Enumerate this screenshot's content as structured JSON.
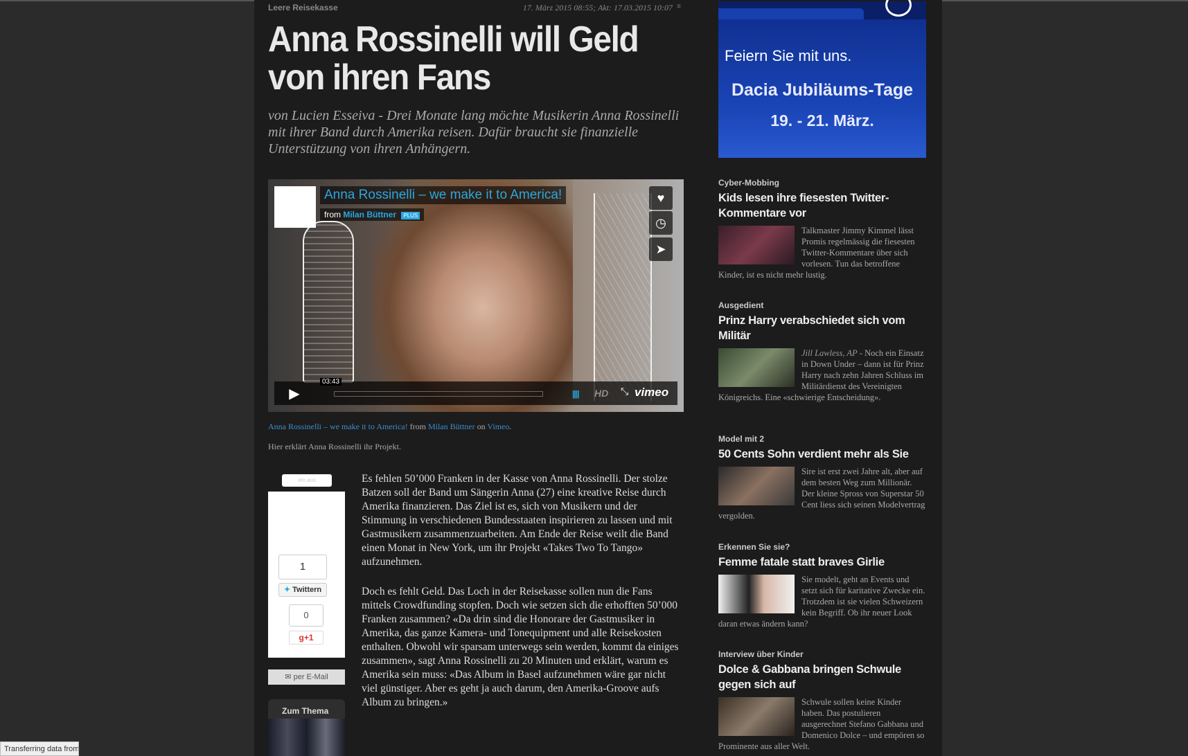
{
  "article": {
    "kicker": "Leere Reisekasse",
    "published": "17. März 2015 08:55;",
    "updated_label": "Akt:",
    "updated": "17.03.2015 10:07",
    "headline": "Anna Rossinelli will Geld von ihren Fans",
    "lead": "von Lucien Esseiva - Drei Monate lang möchte Musikerin Anna Rossinelli mit ihrer Band durch Amerika reisen. Dafür braucht sie finanzielle Unterstützung von ihren Anhängern.",
    "video": {
      "title": "Anna Rossinelli – we make it to America!",
      "from_label": "from",
      "author": "Milan Büttner",
      "plus_badge": "PLUS",
      "duration": "03:43",
      "hd_label": "HD",
      "brand": "vimeo",
      "side_buttons": [
        "heart-icon",
        "clock-icon",
        "send-icon"
      ]
    },
    "credit": {
      "title": "Anna Rossinelli – we make it to America!",
      "from": "from",
      "author": "Milan Büttner",
      "on": "on",
      "platform": "Vimeo",
      "end": "."
    },
    "caption": "Hier erklärt Anna Rossinelli ihr Projekt.",
    "share": {
      "top_tabs": "ein  aus",
      "tweet_count": "1",
      "twitter_label": "Twittern",
      "gplus_count": "0",
      "gplus_label": "g+1",
      "mail_label": "per E-Mail",
      "zum_thema": "Zum Thema"
    },
    "paragraphs": [
      "Es fehlen 50’000 Franken in der Kasse von Anna Rossinelli. Der stolze Batzen soll der Band um Sängerin Anna (27) eine kreative Reise durch Amerika finanzieren. Das Ziel ist es, sich von Musikern und der Stimmung in verschiedenen Bundesstaaten inspirieren zu lassen und mit Gastmusikern zusammenzuarbeiten. Am Ende der Reise weilt die Band einen Monat in New York, um ihr Projekt «Takes Two To Tango» aufzunehmen.",
      "Doch es fehlt Geld. Das Loch in der Reisekasse sollen nun die Fans mittels Crowdfunding stopfen. Doch wie setzen sich die erhofften 50’000 Franken zusammen? «Da drin sind die Honorare der Gastmusiker in Amerika, das ganze Kamera- und Tonequipment und alle Reisekosten enthalten. Obwohl wir sparsam unterwegs sein werden, kommt da einiges zusammen», sagt Anna Rossinelli zu 20 Minuten und erklärt, warum es Amerika sein muss: «Das Album in Basel aufzunehmen wäre gar nicht viel günstiger. Aber es geht ja auch darum, den Amerika-Groove aufs Album zu bringen.»"
    ]
  },
  "ad": {
    "line1": "Feiern Sie mit uns.",
    "line2": "Dacia Jubiläums-Tage",
    "line3": "19. - 21. März."
  },
  "sidebar": {
    "teasers": [
      {
        "kicker": "Cyber-Mobbing",
        "title": "Kids lesen ihre fiesesten Twitter-Kommentare vor",
        "author": "",
        "text": "Talkmaster Jimmy Kimmel lässt Promis regelmässig die fiesesten Twitter-Kommentare über sich vorlesen. Tun das betroffene Kinder, ist es nicht mehr lustig."
      },
      {
        "kicker": "Ausgedient",
        "title": "Prinz Harry verabschiedet sich vom Militär",
        "author": "Jill Lawless, AP",
        "text": " - Noch ein Einsatz in Down Under – dann ist für Prinz Harry nach zehn Jahren Schluss im Militärdienst des Vereinigten Königreichs. Eine «schwierige Entscheidung»."
      },
      {
        "kicker": "Model mit 2",
        "title": "50 Cents Sohn verdient mehr als Sie",
        "author": "",
        "text": "Sire ist erst zwei Jahre alt, aber auf dem besten Weg zum Millionär. Der kleine Spross von Superstar 50 Cent liess sich seinen Modelvertrag vergolden."
      },
      {
        "kicker": "Erkennen Sie sie?",
        "title": "Femme fatale statt braves Girlie",
        "author": "",
        "text": "Sie modelt, geht an Events und setzt sich für karitative Zwecke ein. Trotzdem ist sie vielen Schweizern kein Begriff. Ob ihr neuer Look daran etwas ändern kann?"
      },
      {
        "kicker": "Interview über Kinder",
        "title": "Dolce & Gabbana bringen Schwule gegen sich auf",
        "author": "",
        "text": "Schwule sollen keine Kinder haben. Das postulieren ausgerechnet Stefano Gabbana und Domenico Dolce – und empören so Prominente aus aller Welt."
      }
    ]
  },
  "status_bar": "Transferring data from"
}
